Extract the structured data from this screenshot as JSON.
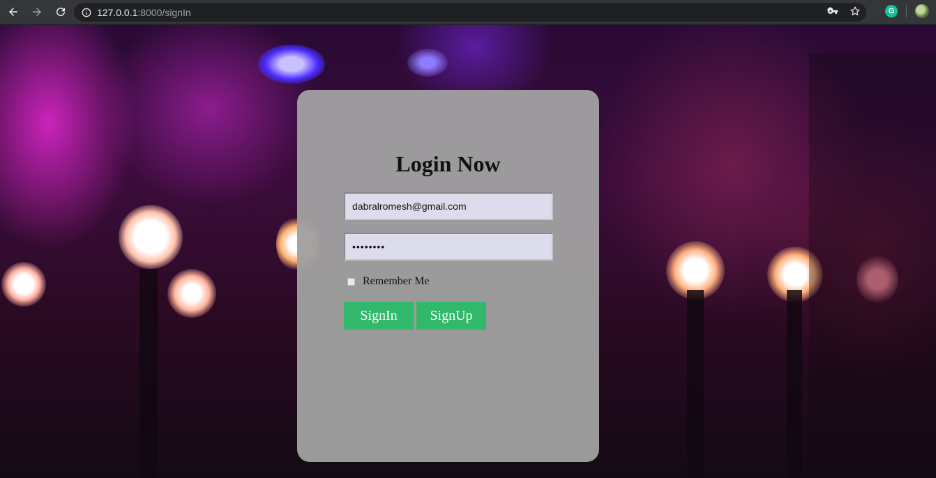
{
  "browser": {
    "url_host": "127.0.0.1",
    "url_path": ":8000/signIn",
    "icons": [
      "back-arrow-icon",
      "forward-arrow-icon",
      "reload-icon",
      "info-icon",
      "key-icon",
      "star-icon",
      "grammarly-icon",
      "profile-avatar"
    ],
    "grammarly_letter": "G"
  },
  "login": {
    "title": "Login Now",
    "email_value": "dabralromesh@gmail.com",
    "password_value": "••••••••",
    "remember_label": "Remember Me",
    "signin_label": "SignIn",
    "signup_label": "SignUp"
  },
  "colors": {
    "button_green": "#31b86a",
    "card_gray": "#a0a0a0",
    "input_fill": "#dcdcec"
  }
}
